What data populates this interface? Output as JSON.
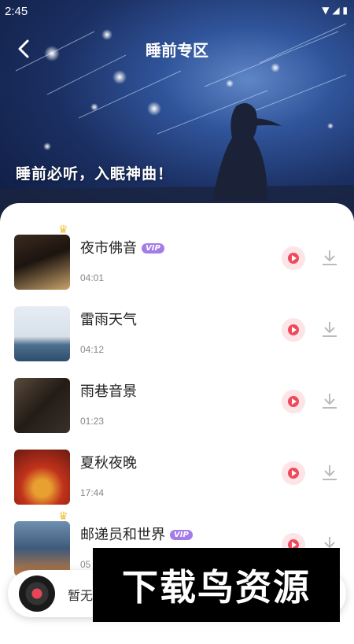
{
  "status_bar": {
    "time": "2:45"
  },
  "header": {
    "title": "睡前专区",
    "subtitle": "睡前必听，入眠神曲！"
  },
  "tracks": [
    {
      "title": "夜市佛音",
      "vip": "VIP",
      "duration": "04:01",
      "crown": true
    },
    {
      "title": "雷雨天气",
      "vip": "",
      "duration": "04:12",
      "crown": false
    },
    {
      "title": "雨巷音景",
      "vip": "",
      "duration": "01:23",
      "crown": false
    },
    {
      "title": "夏秋夜晚",
      "vip": "",
      "duration": "17:44",
      "crown": false
    },
    {
      "title": "邮递员和世界",
      "vip": "VIP",
      "duration": "05",
      "crown": true
    }
  ],
  "player": {
    "status": "暂无"
  },
  "watermark": "下载鸟资源",
  "colors": {
    "accent": "#ee4a5c",
    "vip_badge": "#a47ce8"
  },
  "icons": [
    "back-arrow-icon",
    "play-icon",
    "download-icon",
    "crown-icon",
    "vinyl-disc-icon"
  ]
}
